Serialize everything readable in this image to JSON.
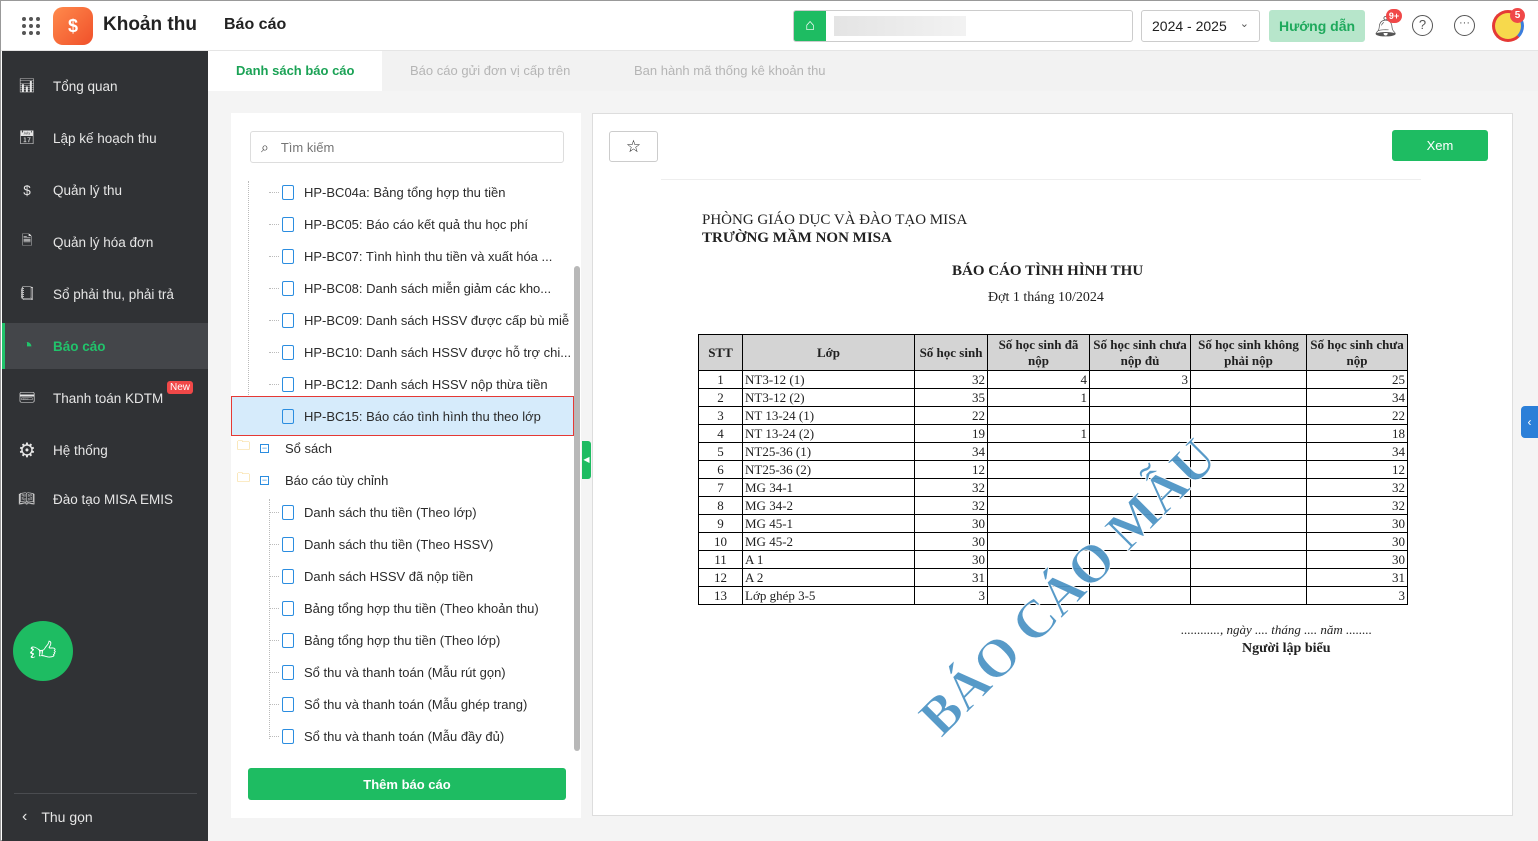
{
  "app": {
    "title": "Khoản thu",
    "page": "Báo cáo"
  },
  "header": {
    "school_year": "2024 - 2025",
    "guide": "Hướng dẫn",
    "notif_badge": "9+",
    "avatar_badge": "5"
  },
  "sidebar": {
    "items": [
      {
        "label": "Tổng quan",
        "icon": "bar-chart-icon"
      },
      {
        "label": "Lập kế hoạch thu",
        "icon": "calendar-money-icon"
      },
      {
        "label": "Quản lý thu",
        "icon": "money-hand-icon"
      },
      {
        "label": "Quản lý hóa đơn",
        "icon": "invoice-icon"
      },
      {
        "label": "Sổ phải thu, phải trả",
        "icon": "ledger-icon"
      },
      {
        "label": "Báo cáo",
        "icon": "pie-chart-icon"
      },
      {
        "label": "Thanh toán KDTM",
        "icon": "payment-icon",
        "badge": "New"
      },
      {
        "label": "Hệ thống",
        "icon": "gear-icon"
      },
      {
        "label": "Đào tạo MISA EMIS",
        "icon": "book-icon"
      }
    ],
    "collapse": "Thu gọn",
    "active": 5
  },
  "tabs": [
    "Danh sách báo cáo",
    "Báo cáo gửi đơn vị cấp trên",
    "Ban hành mã thống kê khoản thu"
  ],
  "search": {
    "placeholder": "Tìm kiếm"
  },
  "tree": {
    "reports": [
      "HP-BC04a: Bảng tổng hợp thu tiền",
      "HP-BC05: Báo cáo kết quả thu học phí",
      "HP-BC07: Tình hình thu tiền và xuất hóa ...",
      "HP-BC08: Danh sách miễn giảm các kho...",
      "HP-BC09: Danh sách HSSV được cấp bù miễ",
      "HP-BC10: Danh sách HSSV được hỗ trợ chi...",
      "HP-BC12: Danh sách HSSV nộp thừa tiền",
      "HP-BC15: Báo cáo tình hình thu theo lớp"
    ],
    "folder1": "Sổ sách",
    "folder2": "Báo cáo tùy chỉnh",
    "custom": [
      "Danh sách thu tiền (Theo lớp)",
      "Danh sách thu tiền (Theo HSSV)",
      "Danh sách HSSV đã nộp tiền",
      "Bảng tổng hợp thu tiền (Theo khoản thu)",
      "Bảng tổng hợp thu tiền (Theo lớp)",
      "Sổ thu và thanh toán (Mẫu rút gọn)",
      "Sổ thu và thanh toán (Mẫu ghép trang)",
      "Sổ thu và thanh toán (Mẫu đầy đủ)"
    ],
    "selected": "HP-BC15: Báo cáo tình hình thu theo lớp"
  },
  "add_report": "Thêm báo cáo",
  "view_button": "Xem",
  "report": {
    "org1": "PHÒNG GIÁO DỤC VÀ ĐÀO TẠO MISA",
    "org2": "TRƯỜNG MẦM NON MISA",
    "title": "BÁO CÁO TÌNH HÌNH THU",
    "subtitle": "Đợt 1 tháng 10/2024",
    "columns": [
      "STT",
      "Lớp",
      "Số học sinh",
      "Số học sinh đã nộp",
      "Số học sinh chưa nộp đủ",
      "Số học sinh không phải nộp",
      "Số học sinh chưa nộp"
    ],
    "rows": [
      [
        "1",
        "NT3-12 (1)",
        "32",
        "4",
        "3",
        "",
        "25"
      ],
      [
        "2",
        "NT3-12 (2)",
        "35",
        "1",
        "",
        "",
        "34"
      ],
      [
        "3",
        "NT 13-24 (1)",
        "22",
        "",
        "",
        "",
        "22"
      ],
      [
        "4",
        "NT 13-24 (2)",
        "19",
        "1",
        "",
        "",
        "18"
      ],
      [
        "5",
        "NT25-36 (1)",
        "34",
        "",
        "",
        "",
        "34"
      ],
      [
        "6",
        "NT25-36 (2)",
        "12",
        "",
        "",
        "",
        "12"
      ],
      [
        "7",
        "MG 34-1",
        "32",
        "",
        "",
        "",
        "32"
      ],
      [
        "8",
        "MG 34-2",
        "32",
        "",
        "",
        "",
        "32"
      ],
      [
        "9",
        "MG 45-1",
        "30",
        "",
        "",
        "",
        "30"
      ],
      [
        "10",
        "MG 45-2",
        "30",
        "",
        "",
        "",
        "30"
      ],
      [
        "11",
        "A 1",
        "30",
        "",
        "",
        "",
        "30"
      ],
      [
        "12",
        "A 2",
        "31",
        "",
        "",
        "",
        "31"
      ],
      [
        "13",
        "Lớp ghép 3-5",
        "3",
        "",
        "",
        "",
        "3"
      ]
    ],
    "date_line": "............, ngày .... tháng .... năm ........",
    "signer": "Người lập biểu",
    "watermark": "BÁO CÁO MẪU"
  },
  "colors": {
    "accent": "#1ebc62",
    "sidebar": "#303235",
    "selected_bg": "#d6ebfb",
    "selected_border": "#e53935",
    "watermark": "#4f95c6"
  }
}
